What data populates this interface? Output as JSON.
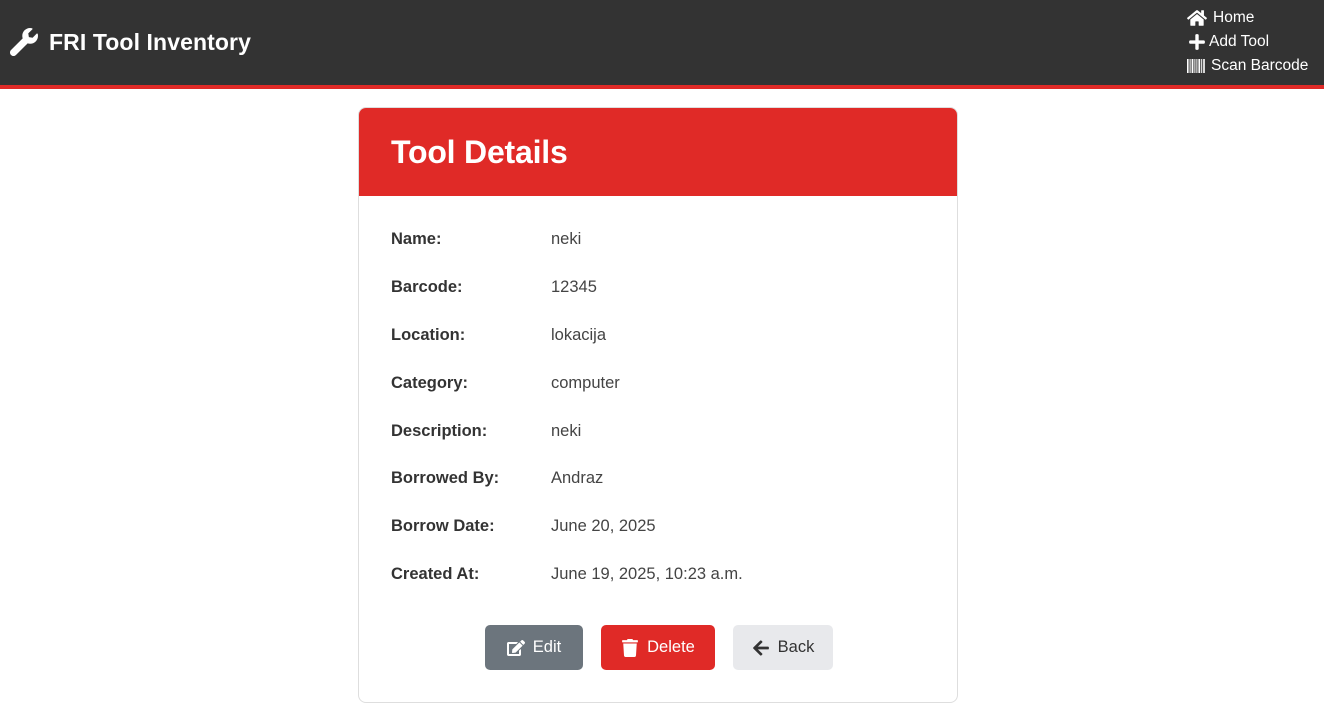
{
  "navbar": {
    "brand": "FRI Tool Inventory",
    "brand_icon": "wrench-icon",
    "links": [
      {
        "label": "Home",
        "icon": "home-icon"
      },
      {
        "label": "Add Tool",
        "icon": "plus-icon"
      },
      {
        "label": "Scan Barcode",
        "icon": "barcode-icon"
      }
    ],
    "accent_color": "#e02a27",
    "background_color": "#333333"
  },
  "card": {
    "title": "Tool Details",
    "details": [
      {
        "label": "Name:",
        "value": "neki"
      },
      {
        "label": "Barcode:",
        "value": "12345"
      },
      {
        "label": "Location:",
        "value": "lokacija"
      },
      {
        "label": "Category:",
        "value": "computer"
      },
      {
        "label": "Description:",
        "value": "neki"
      },
      {
        "label": "Borrowed By:",
        "value": "Andraz"
      },
      {
        "label": "Borrow Date:",
        "value": "June 20, 2025"
      },
      {
        "label": "Created At:",
        "value": "June 19, 2025, 10:23 a.m."
      }
    ],
    "actions": {
      "edit": {
        "label": "Edit",
        "icon": "edit-icon",
        "color": "#6c757d"
      },
      "delete": {
        "label": "Delete",
        "icon": "trash-icon",
        "color": "#e02a27"
      },
      "back": {
        "label": "Back",
        "icon": "arrow-left-icon",
        "color": "#e8e9ec"
      }
    }
  }
}
